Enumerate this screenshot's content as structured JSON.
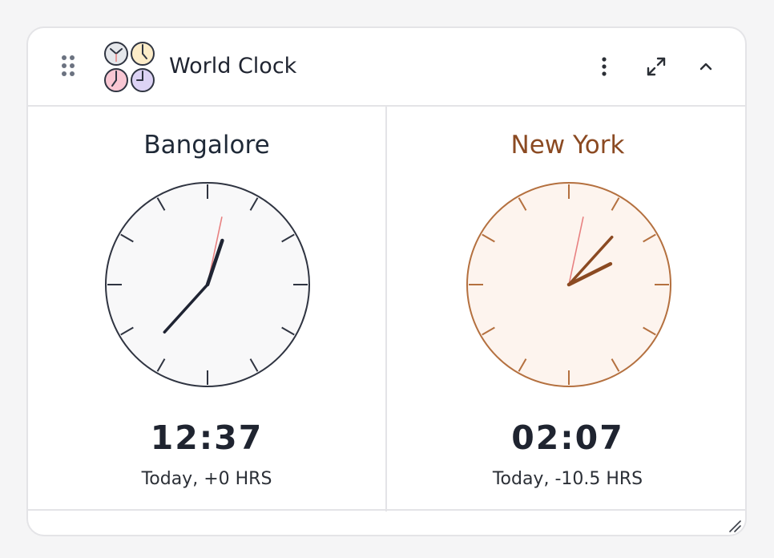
{
  "widget": {
    "title": "World Clock",
    "icons": {
      "drag": "drag-handle-icon",
      "app": "world-clock-app-icon",
      "more": "more-vertical-icon",
      "expand": "expand-icon",
      "collapse": "chevron-up-icon",
      "resize": "resize-handle-icon"
    }
  },
  "clocks": [
    {
      "city": "Bangalore",
      "time": "12:37",
      "offset_label": "Today, +0 HRS",
      "hour": 0,
      "minute": 37,
      "second": 2,
      "colors": {
        "city": "#1f2937",
        "face": "#f8f8f9",
        "border": "#2f3441",
        "hands": "#1f2433",
        "second": "#e88080"
      }
    },
    {
      "city": "New York",
      "time": "02:07",
      "offset_label": "Today, -10.5 HRS",
      "hour": 2,
      "minute": 7,
      "second": 2,
      "colors": {
        "city": "#8b4a22",
        "face": "#fdf4ee",
        "border": "#b4703f",
        "hands": "#8b4a22",
        "second": "#e88080"
      }
    }
  ]
}
